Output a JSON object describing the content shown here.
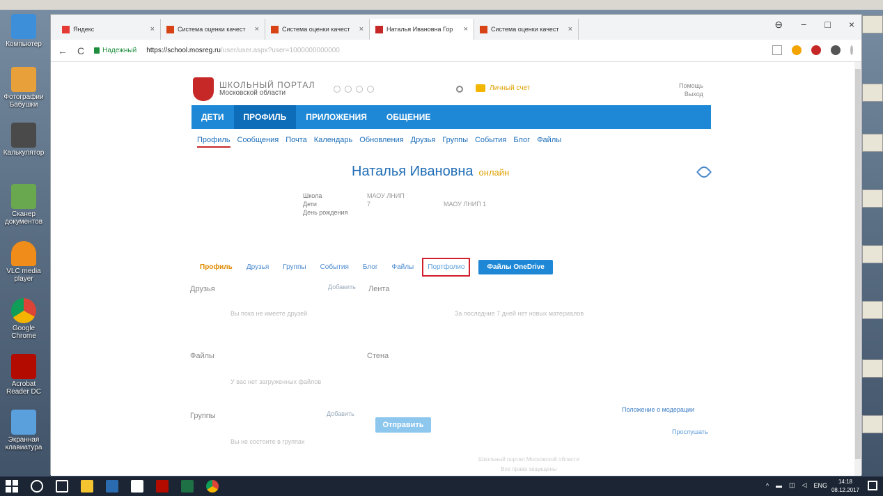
{
  "desktop": {
    "icons": [
      {
        "label": "Компьютер"
      },
      {
        "label": "Фотографии Бабушки"
      },
      {
        "label": "Калькулятор"
      },
      {
        "label": "Сканер документов"
      },
      {
        "label": "VLC media player"
      },
      {
        "label": "Google Chrome"
      },
      {
        "label": "Acrobat Reader DC"
      },
      {
        "label": "Экранная клавиатура"
      }
    ]
  },
  "browser": {
    "tabs": [
      {
        "label": "Яндекс",
        "close": "×"
      },
      {
        "label": "Система оценки качест",
        "close": "×"
      },
      {
        "label": "Система оценки качест",
        "close": "×"
      },
      {
        "label": "Наталья Ивановна Гор",
        "close": "×"
      },
      {
        "label": "Система оценки качест",
        "close": "×"
      }
    ],
    "controls": {
      "back": "←",
      "reload": "C",
      "minimize": "−",
      "maximize": "□",
      "close": "×",
      "profile": "⊖"
    },
    "address": {
      "secure_label": "Надежный",
      "url_main": "https://school.mosreg.ru",
      "url_rest": "/user/user.aspx?user=1000000000000"
    }
  },
  "page": {
    "logo": {
      "line1": "ШКОЛЬНЫЙ ПОРТАЛ",
      "line2": "Московской области"
    },
    "account_label": "Личный счет",
    "top_links": {
      "help": "Помощь",
      "logout": "Выход"
    },
    "nav": [
      "ДЕТИ",
      "ПРОФИЛЬ",
      "ПРИЛОЖЕНИЯ",
      "ОБЩЕНИЕ"
    ],
    "subnav": [
      "Профиль",
      "Сообщения",
      "Почта",
      "Календарь",
      "Обновления",
      "Друзья",
      "Группы",
      "События",
      "Блог",
      "Файлы"
    ],
    "user": {
      "name": "Наталья Ивановна",
      "status": "онлайн"
    },
    "info": [
      {
        "key": "Школа",
        "value": "МАОУ ЛНИП",
        "extra": ""
      },
      {
        "key": "Дети",
        "value": "7",
        "extra": "МАОУ ЛНИП 1"
      },
      {
        "key": "День рождения",
        "value": "",
        "extra": ""
      }
    ],
    "profile_tabs": [
      "Профиль",
      "Друзья",
      "Группы",
      "События",
      "Блог",
      "Файлы",
      "Портфолио",
      "Файлы OneDrive"
    ],
    "friends": {
      "title": "Друзья",
      "action": "Добавить",
      "empty": "Вы пока не имеете друзей"
    },
    "feed": {
      "title": "Лента",
      "empty": "За последние 7 дней нет новых материалов"
    },
    "files": {
      "title": "Файлы",
      "empty": "У вас нет загруженных файлов"
    },
    "wall": {
      "title": "Стена"
    },
    "groups": {
      "title": "Группы",
      "action": "Добавить",
      "empty": "Вы не состоите в группах"
    },
    "send_button": "Отправить",
    "moderation_link": "Положение о модерации",
    "listen_link": "Прослушать",
    "footer": {
      "line1": "Школьный портал Московской области",
      "line2": "Все права защищены"
    }
  },
  "taskbar": {
    "lang": "ENG",
    "time": "14:18",
    "date": "08.12.2017"
  },
  "colors": {
    "accent": "#1e88d6",
    "highlight_red": "#d21f2b",
    "status_orange": "#e0a000"
  }
}
